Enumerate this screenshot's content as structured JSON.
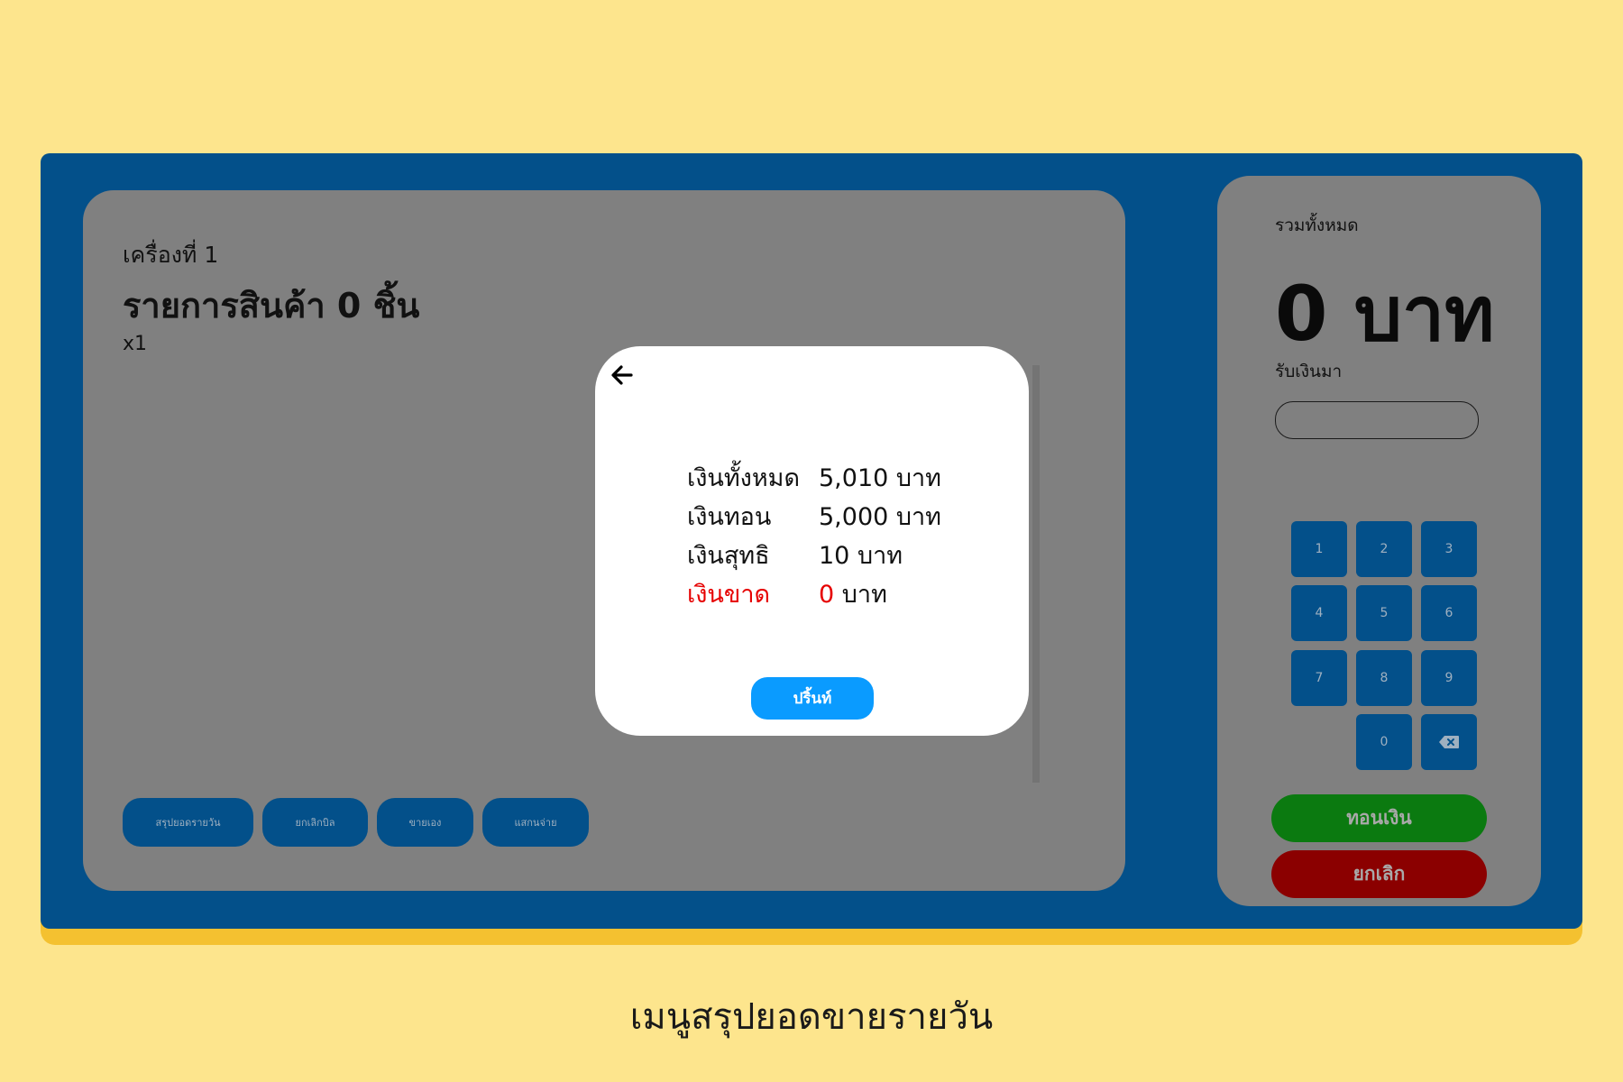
{
  "main": {
    "machine_label": "เครื่องที่ 1",
    "items_title": "รายการสินค้า 0 ชิ้น",
    "multiplier": "x1",
    "actions": [
      "สรุปยอดรายวัน",
      "ยกเลิกบิล",
      "ขายเอง",
      "แสกนจ่าย"
    ]
  },
  "side": {
    "total_label": "รวมทั้งหมด",
    "total_value": "0 บาท",
    "receive_label": "รับเงินมา",
    "receive_value": "",
    "keys": [
      "1",
      "2",
      "3",
      "4",
      "5",
      "6",
      "7",
      "8",
      "9",
      "0"
    ],
    "backspace_icon": "backspace-icon",
    "change_label": "ทอนเงิน",
    "cancel_label": "ยกเลิก"
  },
  "modal": {
    "back_icon": "arrow-left-icon",
    "rows": [
      {
        "label": "เงินทั้งหมด",
        "value": "5,010 บาท"
      },
      {
        "label": "เงินทอน",
        "value": "5,000 บาท"
      },
      {
        "label": "เงินสุทธิ",
        "value": "10 บาท"
      },
      {
        "label": "เงินขาด",
        "amount": "0",
        "unit": "บาท"
      }
    ],
    "print_label": "ปริ้นท์"
  },
  "caption": "เมนูสรุปยอดขายรายวัน",
  "colors": {
    "background": "#fde58d",
    "frame": "#03508a",
    "panel": "#808080",
    "accent_blue": "#0a9bff",
    "change_green": "#0b7a10",
    "cancel_red": "#8b0000",
    "alert_red": "#e60000"
  }
}
